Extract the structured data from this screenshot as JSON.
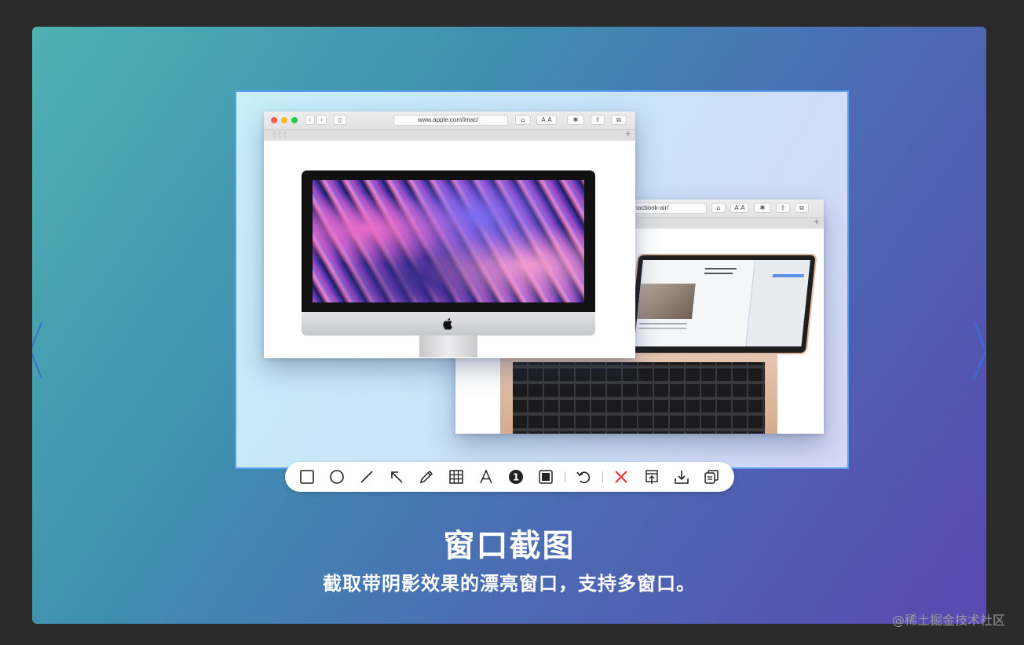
{
  "slide": {
    "title": "窗口截图",
    "subtitle": "截取带阴影效果的漂亮窗口，支持多窗口。"
  },
  "front_window": {
    "url": "www.apple.com/imac/"
  },
  "back_window": {
    "url": "/macbook-air/"
  },
  "text_size_label": "A A",
  "toolbar": {
    "tools": [
      "rectangle-icon",
      "ellipse-icon",
      "line-icon",
      "arrow-icon",
      "pencil-icon",
      "mosaic-icon",
      "text-icon",
      "number-marker-icon",
      "window-frame-icon",
      "undo-icon",
      "close-icon",
      "pin-icon",
      "download-icon",
      "copy-icon"
    ],
    "number_marker": "1",
    "close_color": "#e0322f",
    "accent": "#5a9cf0"
  },
  "watermark": "@稀土掘金技术社区"
}
